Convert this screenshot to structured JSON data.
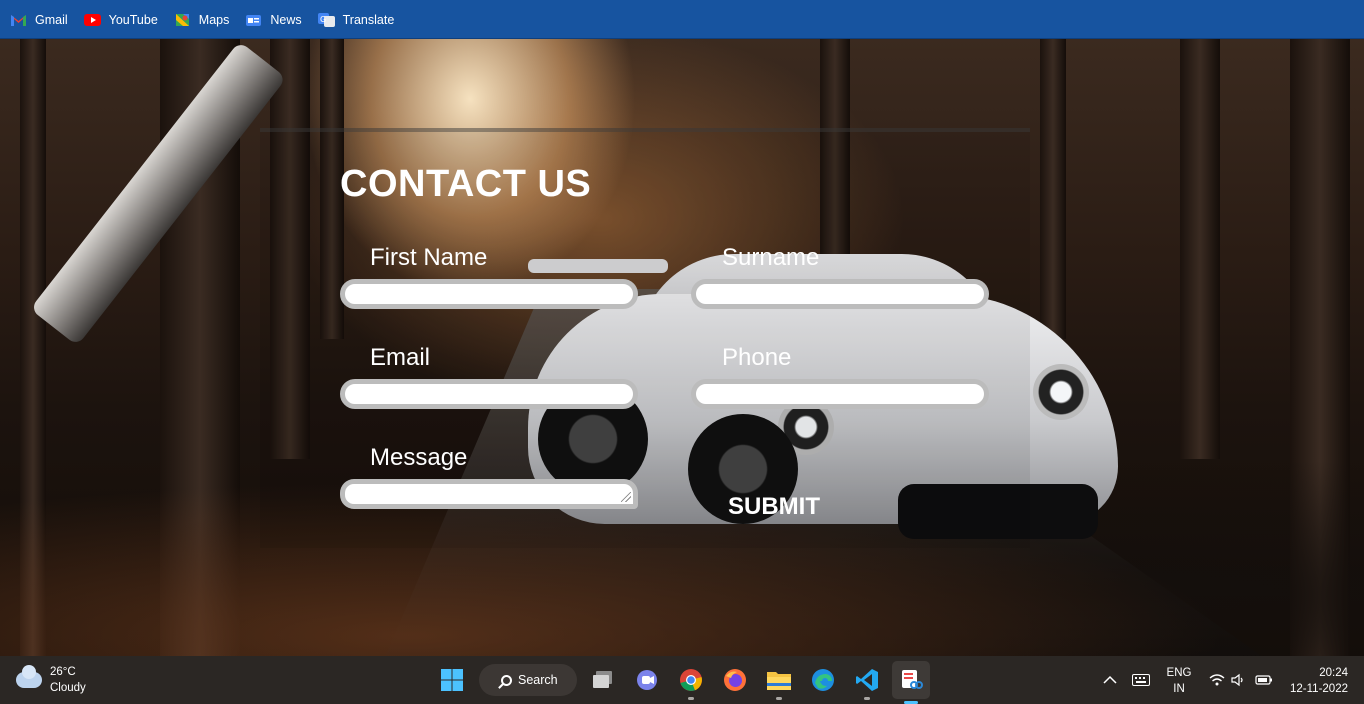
{
  "bookmarks": [
    {
      "label": "Gmail",
      "icon": "gmail-icon",
      "color": "#ea4335"
    },
    {
      "label": "YouTube",
      "icon": "youtube-icon",
      "color": "#ff0000"
    },
    {
      "label": "Maps",
      "icon": "maps-icon",
      "color": "#34a853"
    },
    {
      "label": "News",
      "icon": "news-icon",
      "color": "#4285f4"
    },
    {
      "label": "Translate",
      "icon": "translate-icon",
      "color": "#4285f4"
    }
  ],
  "form": {
    "title": "CONTACT US",
    "first_name_label": "First Name",
    "surname_label": "Surname",
    "email_label": "Email",
    "phone_label": "Phone",
    "message_label": "Message",
    "submit_label": "SUBMIT"
  },
  "taskbar": {
    "weather_temp": "26°C",
    "weather_desc": "Cloudy",
    "search_label": "Search",
    "language": "ENG",
    "region": "IN",
    "time": "20:24",
    "date": "12-11-2022",
    "apps": [
      "windows-start-icon",
      "task-view-icon",
      "chat-icon",
      "chrome-icon",
      "firefox-icon",
      "file-explorer-icon",
      "edge-icon",
      "vscode-icon",
      "snipping-tool-icon"
    ]
  }
}
